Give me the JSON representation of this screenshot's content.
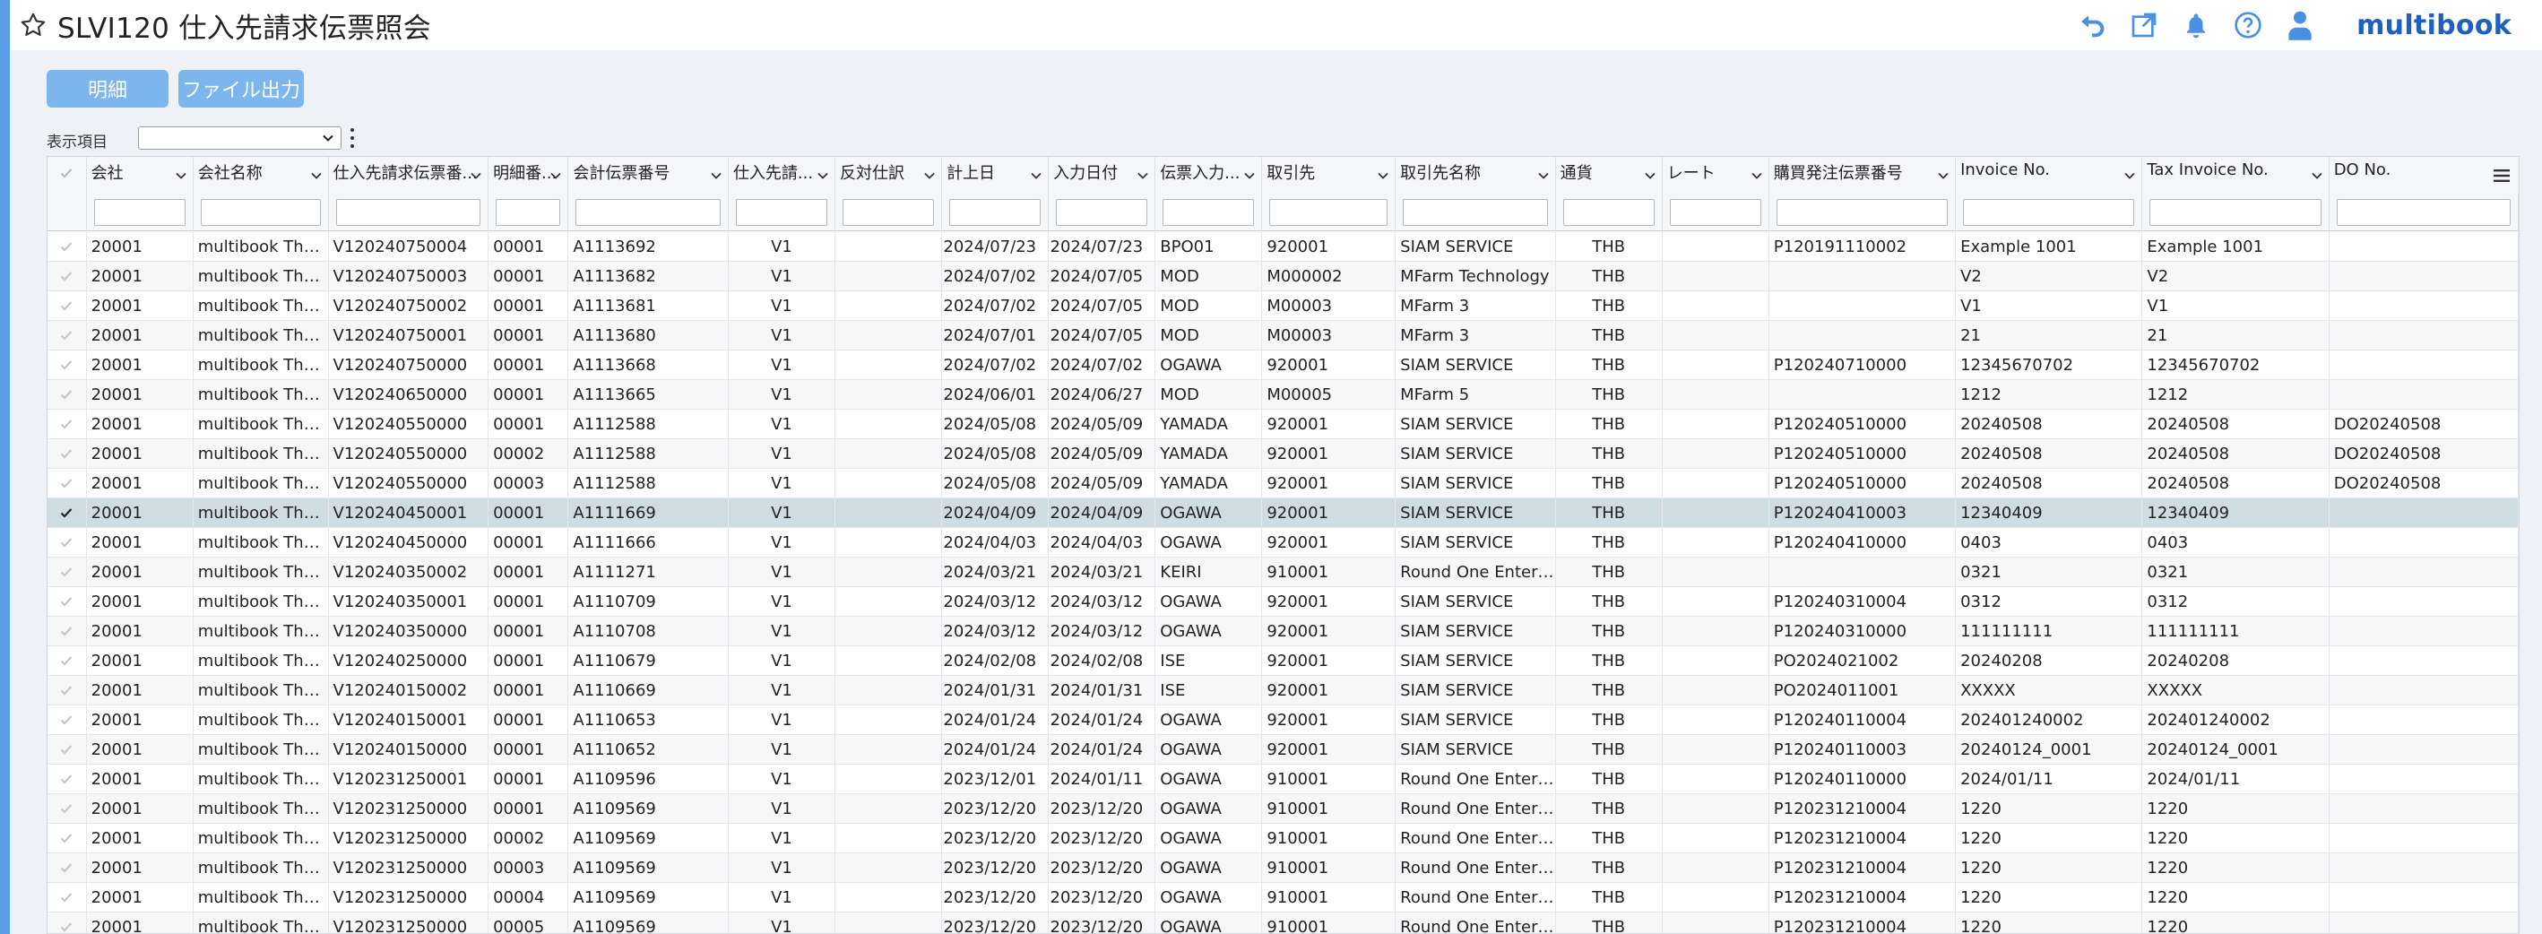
{
  "header": {
    "title": "SLVI120 仕入先請求伝票照会",
    "logo": "multibook"
  },
  "toolbar": {
    "detail_label": "明細",
    "export_label": "ファイル出力",
    "display_items_label": "表示項目",
    "display_items_value": ""
  },
  "colors": {
    "accent": "#5b9de6",
    "button": "#7db5ee",
    "logo": "#1e5fbf",
    "selected_row": "#cfdde3"
  },
  "columns": [
    {
      "key": "chk",
      "label": ""
    },
    {
      "key": "company",
      "label": "会社"
    },
    {
      "key": "company_name",
      "label": "会社名称"
    },
    {
      "key": "invoice_no",
      "label": "仕入先請求伝票番..."
    },
    {
      "key": "line_no",
      "label": "明細番..."
    },
    {
      "key": "acct_no",
      "label": "会計伝票番号"
    },
    {
      "key": "supplier_cat",
      "label": "仕入先請..."
    },
    {
      "key": "reverse",
      "label": "反対仕訳"
    },
    {
      "key": "post_date",
      "label": "計上日"
    },
    {
      "key": "input_date",
      "label": "入力日付"
    },
    {
      "key": "entered_by",
      "label": "伝票入力..."
    },
    {
      "key": "partner",
      "label": "取引先"
    },
    {
      "key": "partner_name",
      "label": "取引先名称"
    },
    {
      "key": "currency",
      "label": "通貨"
    },
    {
      "key": "rate",
      "label": "レート"
    },
    {
      "key": "po_no",
      "label": "購買発注伝票番号"
    },
    {
      "key": "inv",
      "label": "Invoice No."
    },
    {
      "key": "tax_inv",
      "label": "Tax Invoice No."
    },
    {
      "key": "do_no",
      "label": "DO No."
    }
  ],
  "rows": [
    [
      "20001",
      "multibook Tha...",
      "V120240750004",
      "00001",
      "A1113692",
      "V1",
      "",
      "2024/07/23",
      "2024/07/23",
      "BPO01",
      "920001",
      "SIAM SERVICE",
      "THB",
      "",
      "P120191110002",
      "Example 1001",
      "Example 1001",
      ""
    ],
    [
      "20001",
      "multibook Tha...",
      "V120240750003",
      "00001",
      "A1113682",
      "V1",
      "",
      "2024/07/02",
      "2024/07/05",
      "MOD",
      "M000002",
      "MFarm Technology",
      "THB",
      "",
      "",
      "V2",
      "V2",
      ""
    ],
    [
      "20001",
      "multibook Tha...",
      "V120240750002",
      "00001",
      "A1113681",
      "V1",
      "",
      "2024/07/02",
      "2024/07/05",
      "MOD",
      "M00003",
      "MFarm 3",
      "THB",
      "",
      "",
      "V1",
      "V1",
      ""
    ],
    [
      "20001",
      "multibook Tha...",
      "V120240750001",
      "00001",
      "A1113680",
      "V1",
      "",
      "2024/07/01",
      "2024/07/05",
      "MOD",
      "M00003",
      "MFarm 3",
      "THB",
      "",
      "",
      "21",
      "21",
      ""
    ],
    [
      "20001",
      "multibook Tha...",
      "V120240750000",
      "00001",
      "A1113668",
      "V1",
      "",
      "2024/07/02",
      "2024/07/02",
      "OGAWA",
      "920001",
      "SIAM SERVICE",
      "THB",
      "",
      "P120240710000",
      "12345670702",
      "12345670702",
      ""
    ],
    [
      "20001",
      "multibook Tha...",
      "V120240650000",
      "00001",
      "A1113665",
      "V1",
      "",
      "2024/06/01",
      "2024/06/27",
      "MOD",
      "M00005",
      "MFarm 5",
      "THB",
      "",
      "",
      "1212",
      "1212",
      ""
    ],
    [
      "20001",
      "multibook Tha...",
      "V120240550000",
      "00001",
      "A1112588",
      "V1",
      "",
      "2024/05/08",
      "2024/05/09",
      "YAMADA",
      "920001",
      "SIAM SERVICE",
      "THB",
      "",
      "P120240510000",
      "20240508",
      "20240508",
      "DO20240508"
    ],
    [
      "20001",
      "multibook Tha...",
      "V120240550000",
      "00002",
      "A1112588",
      "V1",
      "",
      "2024/05/08",
      "2024/05/09",
      "YAMADA",
      "920001",
      "SIAM SERVICE",
      "THB",
      "",
      "P120240510000",
      "20240508",
      "20240508",
      "DO20240508"
    ],
    [
      "20001",
      "multibook Tha...",
      "V120240550000",
      "00003",
      "A1112588",
      "V1",
      "",
      "2024/05/08",
      "2024/05/09",
      "YAMADA",
      "920001",
      "SIAM SERVICE",
      "THB",
      "",
      "P120240510000",
      "20240508",
      "20240508",
      "DO20240508"
    ],
    [
      "20001",
      "multibook Tha...",
      "V120240450001",
      "00001",
      "A1111669",
      "V1",
      "",
      "2024/04/09",
      "2024/04/09",
      "OGAWA",
      "920001",
      "SIAM SERVICE",
      "THB",
      "",
      "P120240410003",
      "12340409",
      "12340409",
      ""
    ],
    [
      "20001",
      "multibook Tha...",
      "V120240450000",
      "00001",
      "A1111666",
      "V1",
      "",
      "2024/04/03",
      "2024/04/03",
      "OGAWA",
      "920001",
      "SIAM SERVICE",
      "THB",
      "",
      "P120240410000",
      "0403",
      "0403",
      ""
    ],
    [
      "20001",
      "multibook Tha...",
      "V120240350002",
      "00001",
      "A1111271",
      "V1",
      "",
      "2024/03/21",
      "2024/03/21",
      "KEIRI",
      "910001",
      "Round One Entert...",
      "THB",
      "",
      "",
      "0321",
      "0321",
      ""
    ],
    [
      "20001",
      "multibook Tha...",
      "V120240350001",
      "00001",
      "A1110709",
      "V1",
      "",
      "2024/03/12",
      "2024/03/12",
      "OGAWA",
      "920001",
      "SIAM SERVICE",
      "THB",
      "",
      "P120240310004",
      "0312",
      "0312",
      ""
    ],
    [
      "20001",
      "multibook Tha...",
      "V120240350000",
      "00001",
      "A1110708",
      "V1",
      "",
      "2024/03/12",
      "2024/03/12",
      "OGAWA",
      "920001",
      "SIAM SERVICE",
      "THB",
      "",
      "P120240310000",
      "111111111",
      "111111111",
      ""
    ],
    [
      "20001",
      "multibook Tha...",
      "V120240250000",
      "00001",
      "A1110679",
      "V1",
      "",
      "2024/02/08",
      "2024/02/08",
      "ISE",
      "920001",
      "SIAM SERVICE",
      "THB",
      "",
      "PO2024021002",
      "20240208",
      "20240208",
      ""
    ],
    [
      "20001",
      "multibook Tha...",
      "V120240150002",
      "00001",
      "A1110669",
      "V1",
      "",
      "2024/01/31",
      "2024/01/31",
      "ISE",
      "920001",
      "SIAM SERVICE",
      "THB",
      "",
      "PO2024011001",
      "XXXXX",
      "XXXXX",
      ""
    ],
    [
      "20001",
      "multibook Tha...",
      "V120240150001",
      "00001",
      "A1110653",
      "V1",
      "",
      "2024/01/24",
      "2024/01/24",
      "OGAWA",
      "920001",
      "SIAM SERVICE",
      "THB",
      "",
      "P120240110004",
      "202401240002",
      "202401240002",
      ""
    ],
    [
      "20001",
      "multibook Tha...",
      "V120240150000",
      "00001",
      "A1110652",
      "V1",
      "",
      "2024/01/24",
      "2024/01/24",
      "OGAWA",
      "920001",
      "SIAM SERVICE",
      "THB",
      "",
      "P120240110003",
      "20240124_0001",
      "20240124_0001",
      ""
    ],
    [
      "20001",
      "multibook Tha...",
      "V120231250001",
      "00001",
      "A1109596",
      "V1",
      "",
      "2023/12/01",
      "2024/01/11",
      "OGAWA",
      "910001",
      "Round One Entert...",
      "THB",
      "",
      "P120240110000",
      "2024/01/11",
      "2024/01/11",
      ""
    ],
    [
      "20001",
      "multibook Tha...",
      "V120231250000",
      "00001",
      "A1109569",
      "V1",
      "",
      "2023/12/20",
      "2023/12/20",
      "OGAWA",
      "910001",
      "Round One Entert...",
      "THB",
      "",
      "P120231210004",
      "1220",
      "1220",
      ""
    ],
    [
      "20001",
      "multibook Tha...",
      "V120231250000",
      "00002",
      "A1109569",
      "V1",
      "",
      "2023/12/20",
      "2023/12/20",
      "OGAWA",
      "910001",
      "Round One Entert...",
      "THB",
      "",
      "P120231210004",
      "1220",
      "1220",
      ""
    ],
    [
      "20001",
      "multibook Tha...",
      "V120231250000",
      "00003",
      "A1109569",
      "V1",
      "",
      "2023/12/20",
      "2023/12/20",
      "OGAWA",
      "910001",
      "Round One Entert...",
      "THB",
      "",
      "P120231210004",
      "1220",
      "1220",
      ""
    ],
    [
      "20001",
      "multibook Tha...",
      "V120231250000",
      "00004",
      "A1109569",
      "V1",
      "",
      "2023/12/20",
      "2023/12/20",
      "OGAWA",
      "910001",
      "Round One Entert...",
      "THB",
      "",
      "P120231210004",
      "1220",
      "1220",
      ""
    ],
    [
      "20001",
      "multibook Tha...",
      "V120231250000",
      "00005",
      "A1109569",
      "V1",
      "",
      "2023/12/20",
      "2023/12/20",
      "OGAWA",
      "910001",
      "Round One Entert...",
      "THB",
      "",
      "P120231210004",
      "1220",
      "1220",
      ""
    ]
  ],
  "selected_row_index": 9
}
